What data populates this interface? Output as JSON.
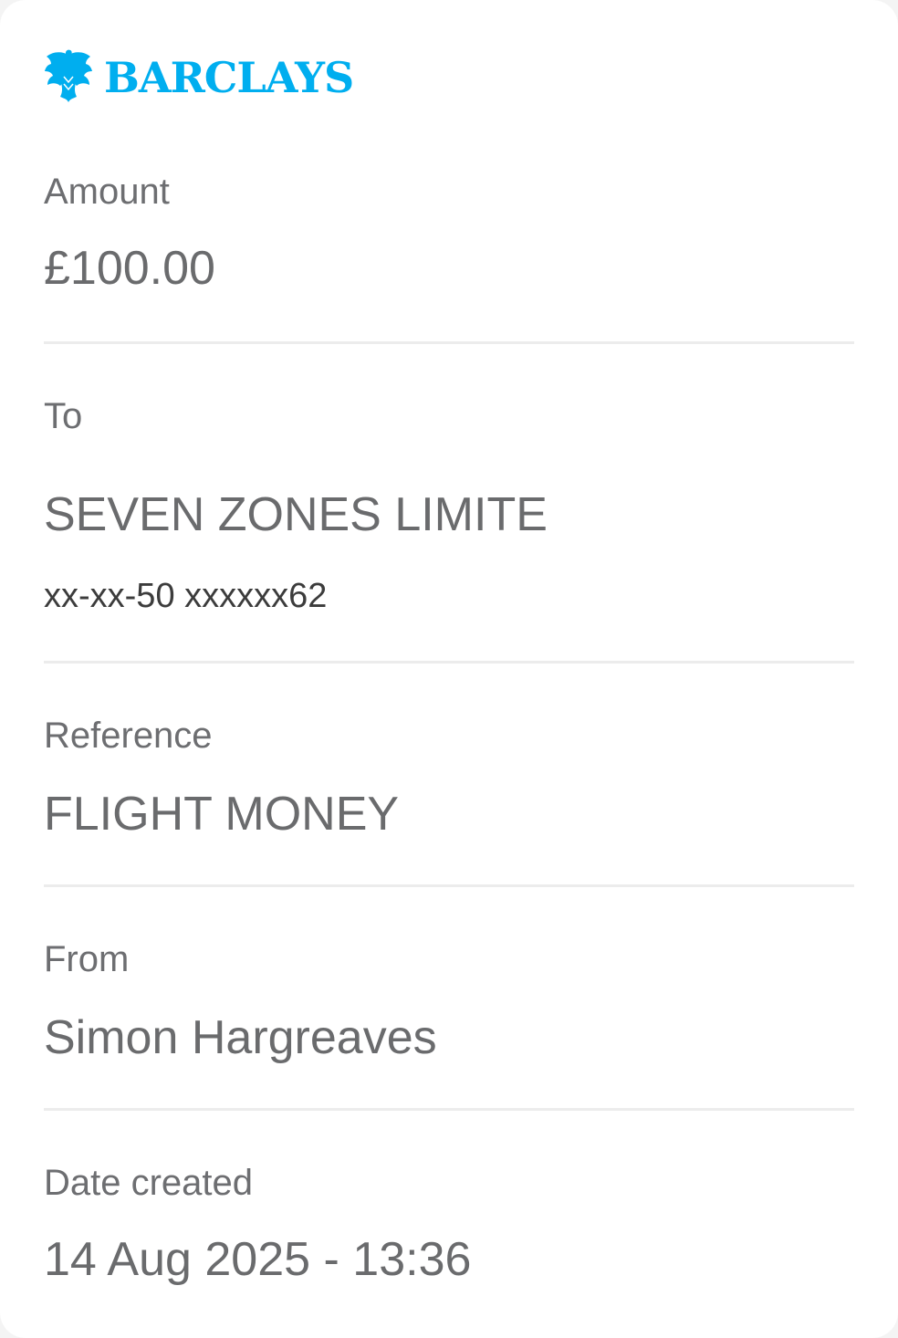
{
  "brand": {
    "name": "BARCLAYS",
    "color": "#00aeef",
    "logo_icon": "eagle-icon"
  },
  "amount": {
    "label": "Amount",
    "value": "£100.00"
  },
  "to": {
    "label": "To",
    "name": "SEVEN ZONES LIMITE",
    "account": "xx-xx-50 xxxxxx62"
  },
  "reference": {
    "label": "Reference",
    "value": "FLIGHT MONEY"
  },
  "from": {
    "label": "From",
    "value": "Simon Hargreaves"
  },
  "date_created": {
    "label": "Date created",
    "value": "14 Aug 2025 - 13:36"
  }
}
